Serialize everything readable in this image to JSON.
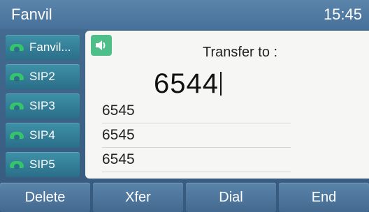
{
  "header": {
    "title": "Fanvil",
    "time": "15:45"
  },
  "lines": [
    {
      "label": "Fanvil..."
    },
    {
      "label": "SIP2"
    },
    {
      "label": "SIP3"
    },
    {
      "label": "SIP4"
    },
    {
      "label": "SIP5"
    }
  ],
  "panel": {
    "speaker_icon": "speaker-icon",
    "prompt": "Transfer to :",
    "number": "6544",
    "history": [
      "6545",
      "6545",
      "6545"
    ]
  },
  "softkeys": [
    "Delete",
    "Xfer",
    "Dial",
    "End"
  ],
  "colors": {
    "header": "#4d77a0",
    "line_button": "#2f7590",
    "line_status_green": "#34c56b",
    "panel_bg": "#f6f6f4",
    "speaker_bg": "#4fbf8a"
  }
}
